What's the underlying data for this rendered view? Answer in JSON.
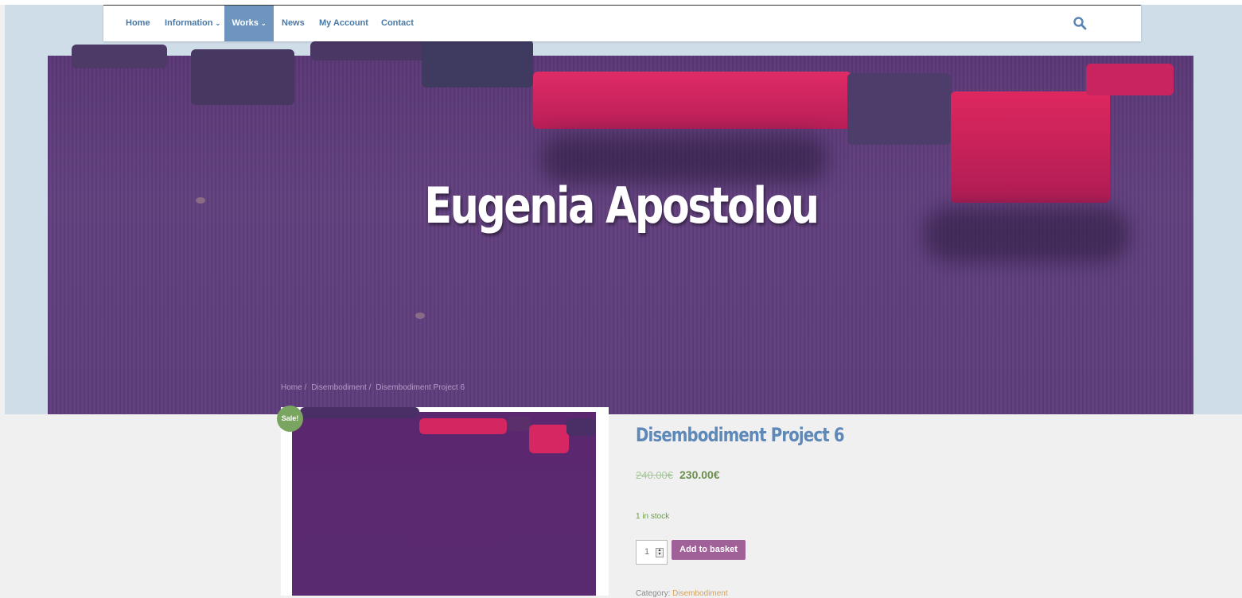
{
  "nav": {
    "items": [
      {
        "label": "Home",
        "has_dropdown": false,
        "active": false
      },
      {
        "label": "Information",
        "has_dropdown": true,
        "active": false
      },
      {
        "label": "Works",
        "has_dropdown": true,
        "active": true
      },
      {
        "label": "News",
        "has_dropdown": false,
        "active": false
      },
      {
        "label": "My Account",
        "has_dropdown": false,
        "active": false
      },
      {
        "label": "Contact",
        "has_dropdown": false,
        "active": false
      }
    ],
    "dropdown_glyph": "⌄",
    "search_icon": "search-icon"
  },
  "hero": {
    "title": "Eugenia Apostolou"
  },
  "breadcrumb": {
    "items": [
      "Home",
      "Disembodiment",
      "Disembodiment Project 6"
    ],
    "separator": "/"
  },
  "product": {
    "sale_badge": "Sale!",
    "title": "Disembodiment Project 6",
    "price_old": "240.00€",
    "price_new": "230.00€",
    "stock": "1 in stock",
    "quantity": "1",
    "add_to_basket": "Add to basket",
    "category_label": "Category:",
    "category_value": "Disembodiment"
  },
  "colors": {
    "nav_text": "#4a78a5",
    "nav_active_bg": "#6d95bf",
    "hero_sky": "#cfdde9",
    "hero_paint": "#5f3d7c",
    "crust_pink": "#d9245e",
    "product_title": "#5d88b7",
    "price_new": "#6a8f4e",
    "sale_badge": "#7aa560",
    "basket_button": "#a06199",
    "page_bg": "#f0f0f0"
  }
}
